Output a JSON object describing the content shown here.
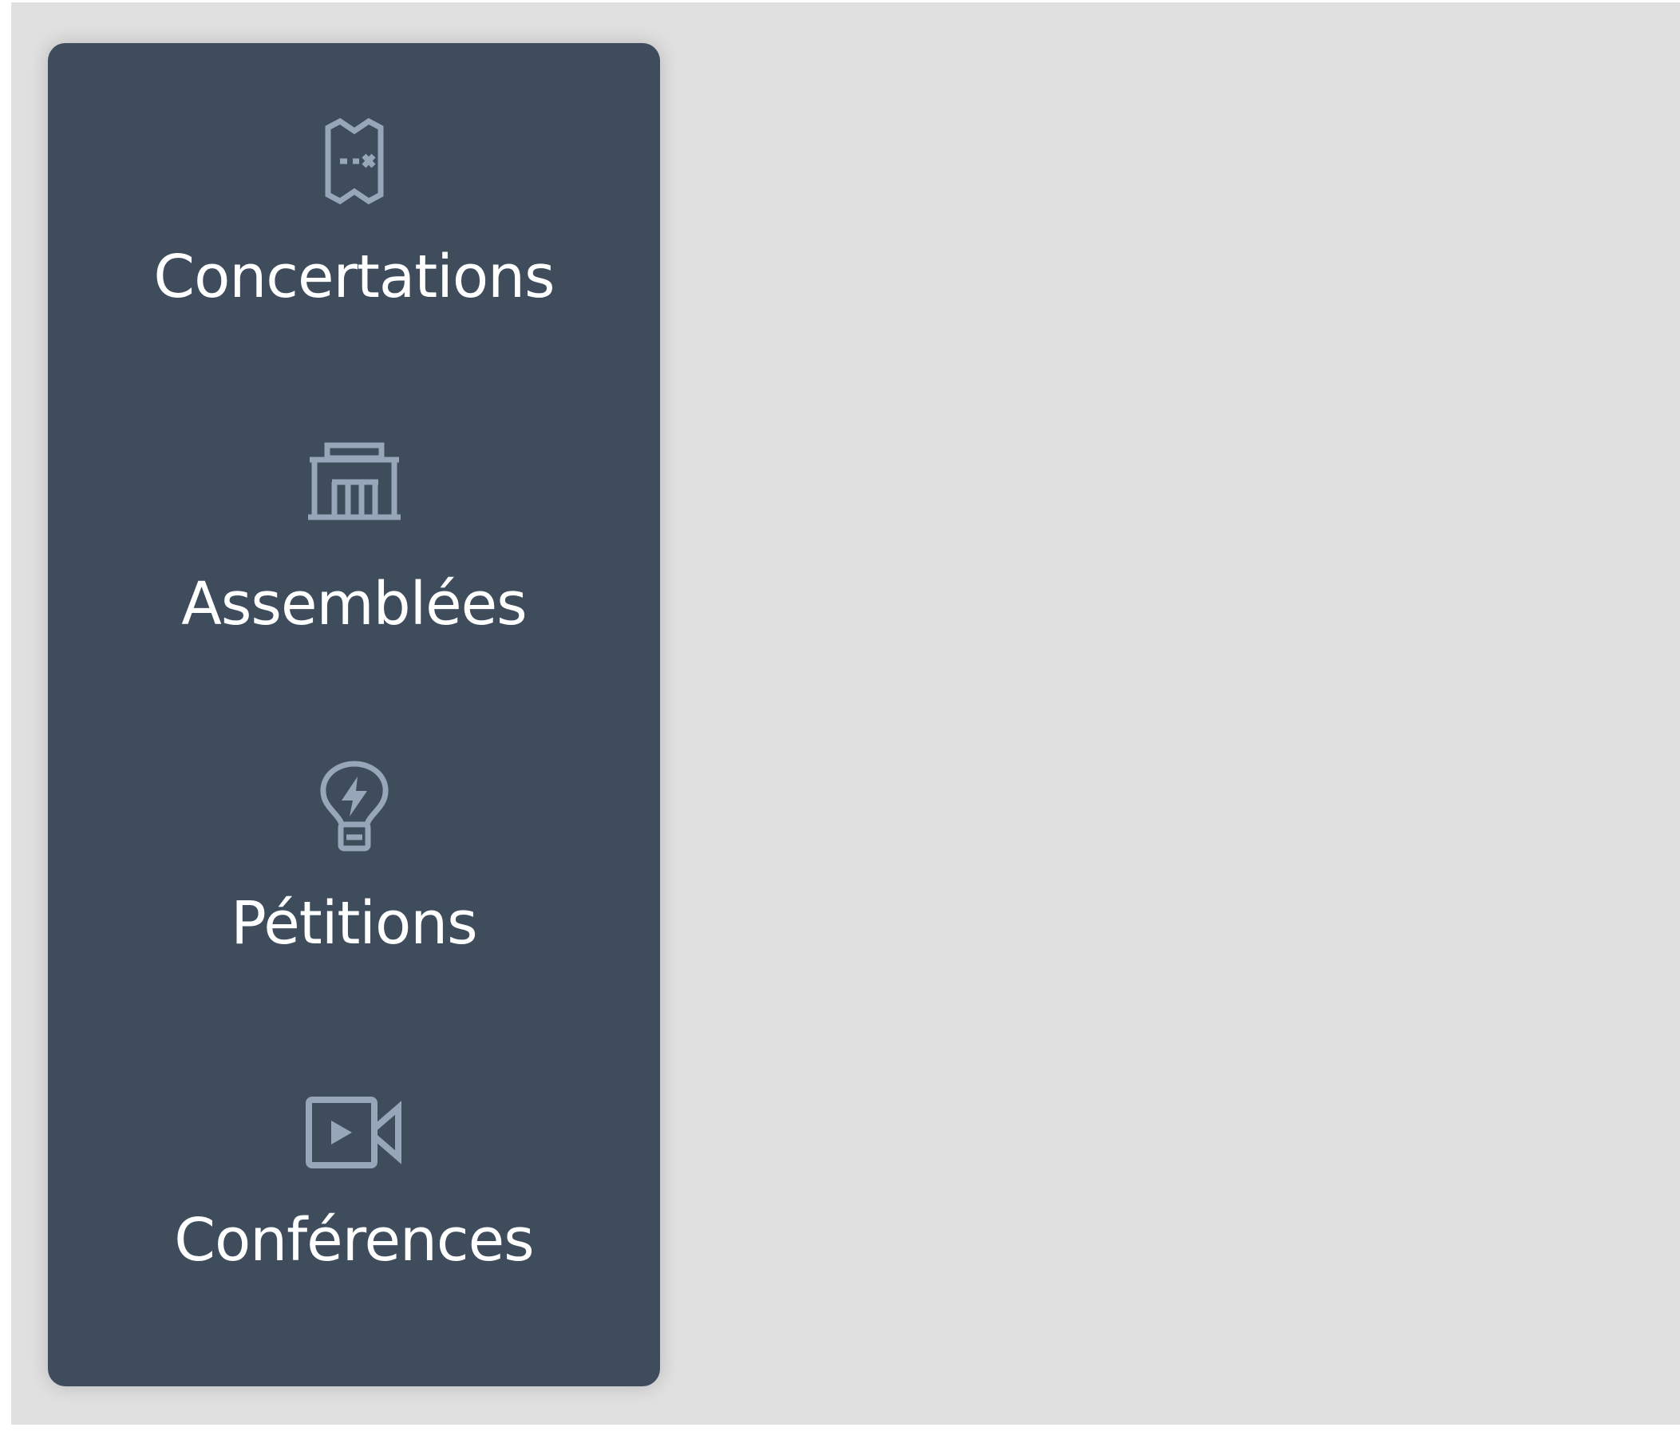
{
  "theme": {
    "panel_color": "#3e4c5c",
    "icon_color": "#97a6b8",
    "label_color": "#ffffff",
    "backdrop_color": "#e0e0e0"
  },
  "nav": {
    "items": [
      {
        "label": "Concertations",
        "icon": "map-icon"
      },
      {
        "label": "Assemblées",
        "icon": "building-icon"
      },
      {
        "label": "Pétitions",
        "icon": "lightbulb-icon"
      },
      {
        "label": "Conférences",
        "icon": "video-camera-icon"
      }
    ]
  }
}
